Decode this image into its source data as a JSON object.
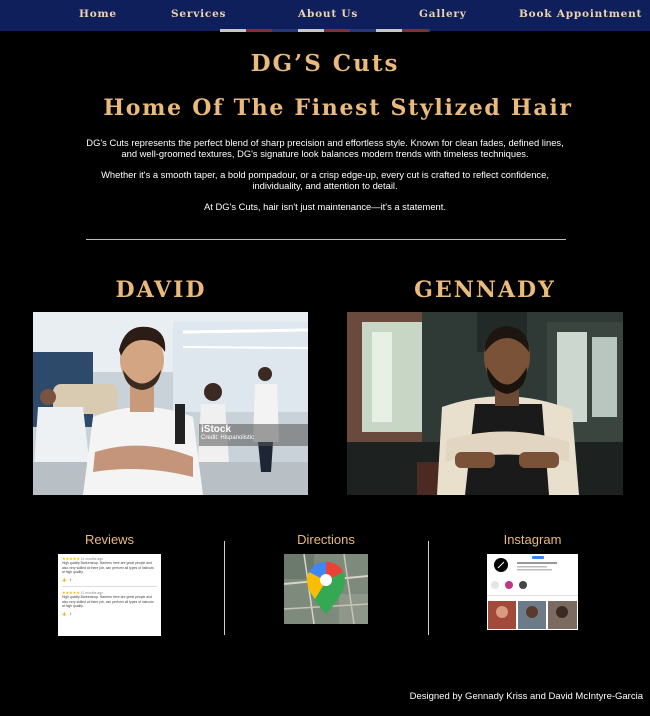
{
  "nav": {
    "items": [
      {
        "label": "Home"
      },
      {
        "label": "Services"
      },
      {
        "label": "About Us"
      },
      {
        "label": "Gallery"
      },
      {
        "label": "Book Appointment"
      }
    ]
  },
  "brand": "DG’S Cuts",
  "headline": "Home Of The Finest Stylized Hair",
  "intro": [
    "DG's Cuts represents the perfect blend of sharp precision and effortless style. Known for clean fades, defined lines, and well-groomed textures, DG's signature look balances modern trends with timeless techniques.",
    "Whether it's a smooth taper, a bold pompadour, or a crisp edge-up, every cut is crafted to reflect confidence, individuality, and attention to detail.",
    "At DG's Cuts, hair isn't just maintenance—it's a statement."
  ],
  "barbers": [
    {
      "name": "DAVID",
      "watermark": "iStock",
      "credit": "Credit: Hispanolistic"
    },
    {
      "name": "GENNADY"
    }
  ],
  "links": {
    "reviews": {
      "title": "Reviews",
      "snippet": "High quality Barbershop. Barbers here are great people and also very skilled at there job, can perform all types of haircuts at high quality.",
      "time": "11 months ago"
    },
    "directions": {
      "title": "Directions"
    },
    "instagram": {
      "title": "Instagram"
    }
  },
  "footer": "Designed by Gennady Kriss and David McIntyre-Garcia",
  "colors": {
    "nav_bg": "#0e1f5b",
    "gold": "#eab97c",
    "nav_text": "#ecd3ad",
    "bg": "#000000"
  }
}
